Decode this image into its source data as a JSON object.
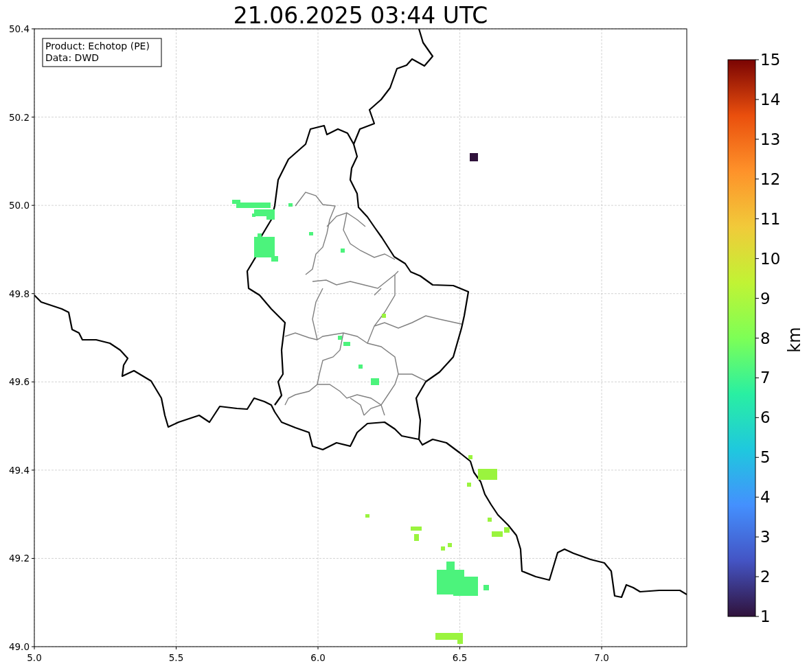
{
  "title": "21.06.2025 03:44 UTC",
  "legend": [
    "Product: Echotop (PE)",
    "Data: DWD"
  ],
  "map": {
    "x_ticks": [
      "5.0",
      "5.5",
      "6.0",
      "6.5",
      "7.0"
    ],
    "y_ticks": [
      "50.4",
      "50.2",
      "50.0",
      "49.8",
      "49.6",
      "49.4",
      "49.2",
      "49.0"
    ]
  },
  "colorbar": {
    "label": "km",
    "ticks": [
      "15",
      "14",
      "13",
      "12",
      "11",
      "10",
      "9",
      "8",
      "7",
      "6",
      "5",
      "4",
      "3",
      "2",
      "1"
    ]
  }
}
